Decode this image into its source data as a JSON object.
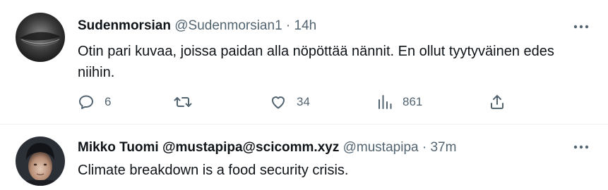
{
  "tweets": [
    {
      "display_name": "Sudenmorsian",
      "handle": "@Sudenmorsian1",
      "separator": "·",
      "time": "14h",
      "text": "Otin pari kuvaa, joissa paidan alla nöpöttää nännit. En ollut tyytyväinen edes niihin.",
      "stats": {
        "replies": "6",
        "likes": "34",
        "views": "861"
      }
    },
    {
      "display_name": "Mikko Tuomi @mustapipa@scicomm.xyz",
      "handle": "@mustapipa",
      "separator": "·",
      "time": "37m",
      "text": "Climate breakdown is a food security crisis."
    }
  ],
  "icons": {
    "more": "more-horizontal-icon",
    "reply": "reply-icon",
    "retweet": "retweet-icon",
    "like": "heart-icon",
    "views": "views-icon",
    "share": "share-icon"
  },
  "colors": {
    "text": "#0f1419",
    "muted": "#536471",
    "divider": "#eff3f4"
  }
}
